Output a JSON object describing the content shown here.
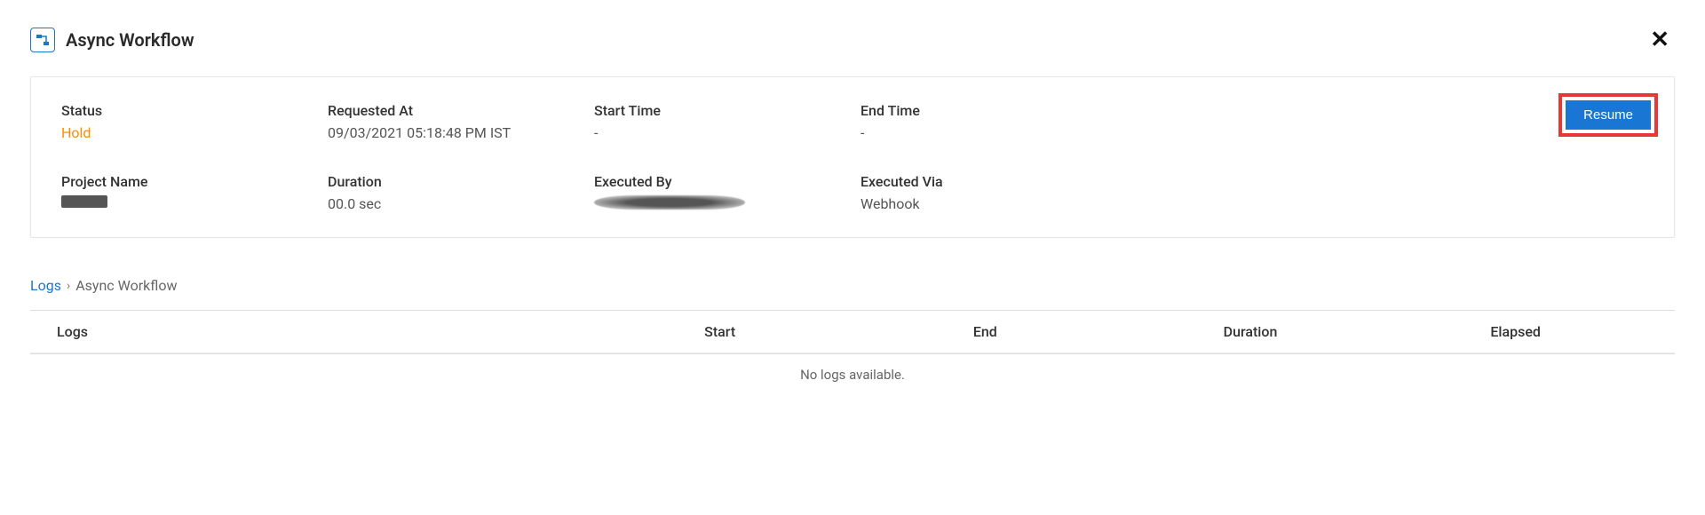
{
  "header": {
    "title": "Async Workflow"
  },
  "details": {
    "status_label": "Status",
    "status_value": "Hold",
    "requested_at_label": "Requested At",
    "requested_at_value": "09/03/2021 05:18:48 PM IST",
    "start_time_label": "Start Time",
    "start_time_value": "-",
    "end_time_label": "End Time",
    "end_time_value": "-",
    "project_name_label": "Project Name",
    "project_name_value": "",
    "duration_label": "Duration",
    "duration_value": "00.0 sec",
    "executed_by_label": "Executed By",
    "executed_by_value": "",
    "executed_via_label": "Executed Via",
    "executed_via_value": "Webhook",
    "resume_button": "Resume"
  },
  "breadcrumb": {
    "root": "Logs",
    "current": "Async Workflow"
  },
  "logs_table": {
    "columns": {
      "logs": "Logs",
      "start": "Start",
      "end": "End",
      "duration": "Duration",
      "elapsed": "Elapsed"
    },
    "empty_message": "No logs available."
  }
}
